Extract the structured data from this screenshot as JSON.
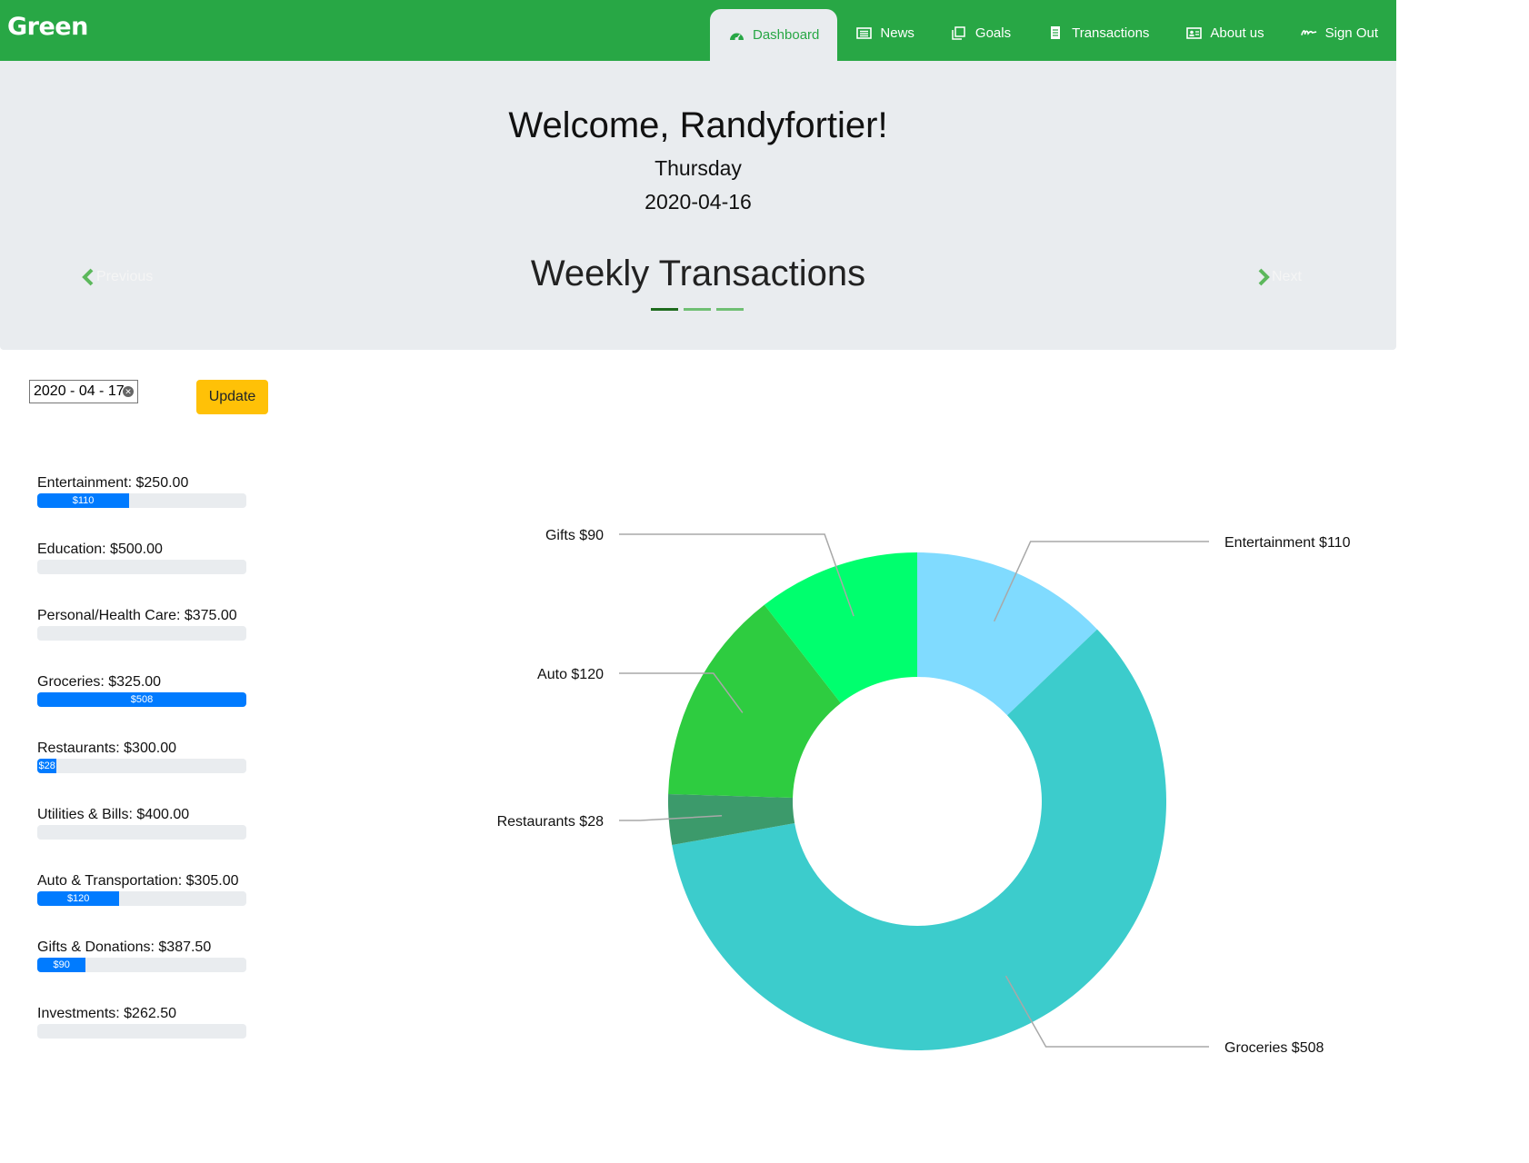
{
  "nav": {
    "brand": "Green",
    "items": [
      {
        "label": "Dashboard",
        "icon": "dashboard-icon",
        "active": true
      },
      {
        "label": "News",
        "icon": "newspaper-icon",
        "active": false
      },
      {
        "label": "Goals",
        "icon": "copy-icon",
        "active": false
      },
      {
        "label": "Transactions",
        "icon": "receipt-icon",
        "active": false
      },
      {
        "label": "About us",
        "icon": "id-card-icon",
        "active": false
      },
      {
        "label": "Sign Out",
        "icon": "signature-icon",
        "active": false
      }
    ],
    "brand_color": "#28a745"
  },
  "header": {
    "welcome": "Welcome, Randyfortier!",
    "day": "Thursday",
    "date": "2020-04-16"
  },
  "carousel": {
    "title": "Weekly Transactions",
    "prev_label": "Previous",
    "next_label": "Next",
    "indicator_count": 3,
    "active_indicator": 0
  },
  "form": {
    "date_value": "2020 - 04 - 17",
    "update_label": "Update"
  },
  "budgets": [
    {
      "label": "Entertainment: $250.00",
      "spent_label": "$110",
      "fraction": 0.44
    },
    {
      "label": "Education: $500.00",
      "spent_label": "",
      "fraction": 0
    },
    {
      "label": "Personal/Health Care: $375.00",
      "spent_label": "",
      "fraction": 0
    },
    {
      "label": "Groceries: $325.00",
      "spent_label": "$508",
      "fraction": 1.0
    },
    {
      "label": "Restaurants: $300.00",
      "spent_label": "$28",
      "fraction": 0.093
    },
    {
      "label": "Utilities & Bills: $400.00",
      "spent_label": "",
      "fraction": 0
    },
    {
      "label": "Auto & Transportation: $305.00",
      "spent_label": "$120",
      "fraction": 0.393
    },
    {
      "label": "Gifts & Donations: $387.50",
      "spent_label": "$90",
      "fraction": 0.232
    },
    {
      "label": "Investments: $262.50",
      "spent_label": "",
      "fraction": 0
    }
  ],
  "colors": {
    "progress": "#007bff",
    "update_button": "#ffc107",
    "jumbotron": "#e9ecef"
  },
  "chart_data": {
    "type": "pie",
    "donut": true,
    "slices": [
      {
        "name": "Entertainment",
        "value": 110,
        "label": "Entertainment $110",
        "color": "#80dbff"
      },
      {
        "name": "Groceries",
        "value": 508,
        "label": "Groceries $508",
        "color": "#3ccccc"
      },
      {
        "name": "Restaurants",
        "value": 28,
        "label": "Restaurants $28",
        "color": "#3c9a6b"
      },
      {
        "name": "Auto",
        "value": 120,
        "label": "Auto $120",
        "color": "#2ecc40"
      },
      {
        "name": "Gifts",
        "value": 90,
        "label": "Gifts $90",
        "color": "#00ff6e"
      }
    ]
  }
}
